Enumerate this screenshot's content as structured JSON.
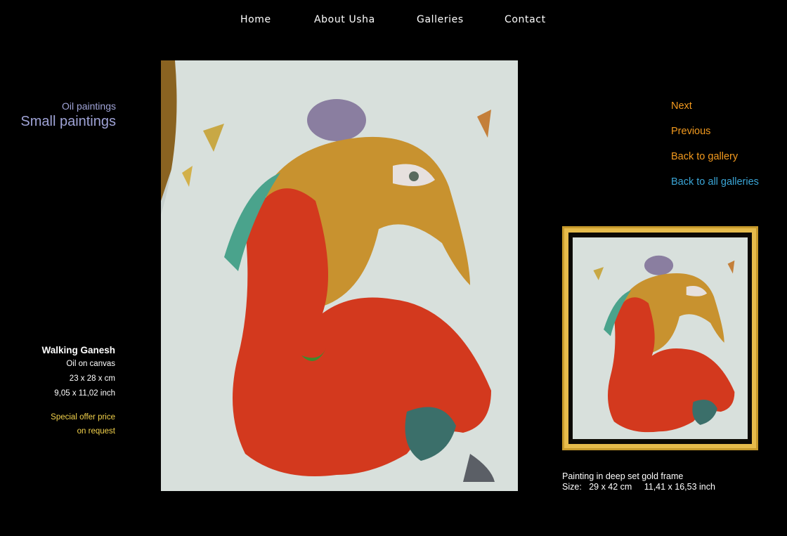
{
  "nav": {
    "home": "Home",
    "about": "About Usha",
    "galleries": "Galleries",
    "contact": "Contact"
  },
  "categories": {
    "oil": "Oil paintings",
    "small": "Small paintings"
  },
  "artwork": {
    "title": "Walking Ganesh",
    "medium": "Oil  on canvas",
    "size_cm": "23 x 28 x cm",
    "size_inch": "9,05 x 11,02 inch",
    "offer_line1": "Special offer price",
    "offer_line2": "on request"
  },
  "pager": {
    "next": "Next",
    "previous": "Previous",
    "back_gallery": "Back to gallery",
    "back_all": "Back to all galleries"
  },
  "frame_caption": {
    "line1": "Painting in deep set gold frame",
    "line2": "Size:   29 x 42 cm     11,41 x 16,53 inch"
  },
  "colors": {
    "nav_text": "#ffffff",
    "category_text": "#9fa3d6",
    "pager_orange": "#f39a1e",
    "pager_blue": "#3aa5d6",
    "offer_text": "#f3d24b",
    "frame_gold": "#e6bb4b"
  }
}
